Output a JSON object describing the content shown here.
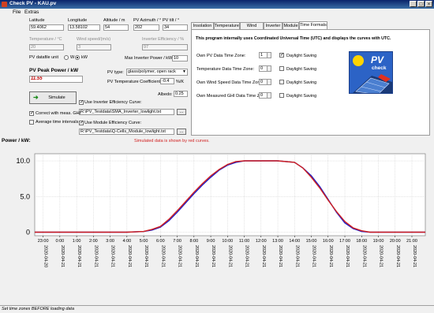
{
  "window": {
    "title": "Check PV - KAU.pv",
    "min": "_",
    "max": "□",
    "close": "×"
  },
  "menu": {
    "file": "File",
    "extras": "Extras"
  },
  "site": {
    "latitude_label": "Latitude",
    "latitude": "59.4062",
    "longitude_label": "Longitude",
    "longitude": "13.58102",
    "altitude_label": "Altitude / m",
    "altitude": "54",
    "azimuth_label": "PV Azimuth / °",
    "azimuth": "202",
    "tilt_label": "PV tilt / °",
    "tilt": "34"
  },
  "temperature": {
    "label": "Temperature / °C",
    "value": "20"
  },
  "wind": {
    "label": "Wind speed/(m/s)",
    "value": "3"
  },
  "inverter_eff": {
    "label": "Inverter Efficiency / %",
    "value": "97"
  },
  "datafile_unit": {
    "label": "PV datafile unit",
    "opt_w": "W",
    "opt_kw": "kW"
  },
  "max_inverter": {
    "label": "Max Inverter Power / kW:",
    "value": "10"
  },
  "peak_power": {
    "label": "PV Peak Power / kW",
    "value": "11.55"
  },
  "pv_type": {
    "label": "PV type:",
    "value": "glass/polymer, open rack"
  },
  "temp_coeff": {
    "label": "PV Temperature Coefficient:",
    "value": "-0.4",
    "unit": "%/K"
  },
  "simulate_button": "Simulate",
  "correct_ghi": "Correct with meas. GHI",
  "average_intervals": "Average time intervals",
  "albedo": {
    "label": "Albedo:",
    "value": "0.25"
  },
  "inverter_curve": {
    "label": "Use Inverter Efficiency Curve:",
    "path": "R:\\PV_Testdata\\SMA_Inverter_lowlight.txt",
    "browse": "..."
  },
  "module_curve": {
    "label": "Use Module Efficiency Curve:",
    "path": "R:\\PV_Testdata\\Q-Cells_Module_lowlight.txt",
    "browse": "..."
  },
  "sim_note": "Simulated data is shown by red curves.",
  "tabs": [
    "Insolation",
    "Temperature",
    "Wind speed",
    "Inverter",
    "Module",
    "Time Formats"
  ],
  "time_formats": {
    "info": "This program internally uses Coordinated Universal Time (UTC) and displays the curves with UTC.",
    "daylight_label": "Daylight Saving",
    "rows": [
      {
        "label": "Own PV Data Time Zone:",
        "value": "1",
        "dst": true
      },
      {
        "label": "Temperature Data Time Zone:",
        "value": "0",
        "dst": false
      },
      {
        "label": "Own Wind Speed Data Time Zone:",
        "value": "0",
        "dst": false
      },
      {
        "label": "Own Measured GHI Data Time Zone:",
        "value": "0",
        "dst": false
      }
    ]
  },
  "logo": {
    "line1": "PV",
    "line2": "check"
  },
  "status": "Set time zones BEFORE loading data",
  "chart_data": {
    "type": "line",
    "ylabel": "Power / kW:",
    "ylim": [
      -0.5,
      11
    ],
    "yticks": [
      0,
      5.0,
      10.0
    ],
    "yticklabels": [
      "0",
      "5.0",
      "10.0"
    ],
    "xticklabels": [
      "23:00",
      "0:00",
      "1:00",
      "2:00",
      "3:00",
      "4:00",
      "5:00",
      "6:00",
      "7:00",
      "8:00",
      "9:00",
      "10:00",
      "11:00",
      "12:00",
      "13:00",
      "14:00",
      "15:00",
      "16:00",
      "17:00",
      "18:00",
      "19:00",
      "20:00",
      "21:00"
    ],
    "xdates": [
      "2020-04-20",
      "2020-04-21",
      "2020-04-21",
      "2020-04-21",
      "2020-04-21",
      "2020-04-21",
      "2020-04-21",
      "2020-04-21",
      "2020-04-21",
      "2020-04-21",
      "2020-04-21",
      "2020-04-21",
      "2020-04-21",
      "2020-04-21",
      "2020-04-21",
      "2020-04-21",
      "2020-04-21",
      "2020-04-21",
      "2020-04-21",
      "2020-04-21",
      "2020-04-21",
      "2020-04-21",
      "2020-04-21"
    ],
    "grid": true,
    "series": [
      {
        "color": "#1c1cc8",
        "x": [
          -1.5,
          4.0,
          5.0,
          5.5,
          6.0,
          6.5,
          7.0,
          7.5,
          8.0,
          8.5,
          9.0,
          9.5,
          10.0,
          10.5,
          11.0,
          12.0,
          13.0,
          14.0,
          14.5,
          15.0,
          15.5,
          16.0,
          16.5,
          17.0,
          17.5,
          18.0,
          18.5,
          19.0,
          21.8
        ],
        "y": [
          0,
          0,
          0.1,
          0.3,
          0.7,
          1.6,
          2.8,
          4.1,
          5.4,
          6.6,
          7.7,
          8.7,
          9.4,
          9.8,
          10.0,
          10.0,
          10.0,
          9.8,
          9.0,
          7.9,
          6.4,
          4.6,
          2.8,
          1.3,
          0.5,
          0.1,
          0,
          0,
          0
        ]
      },
      {
        "color": "#d02020",
        "x": [
          -1.5,
          4.0,
          5.0,
          5.5,
          6.0,
          6.5,
          7.0,
          7.5,
          8.0,
          8.5,
          9.0,
          9.5,
          10.0,
          10.5,
          11.0,
          12.0,
          13.0,
          14.0,
          14.5,
          15.0,
          15.5,
          16.0,
          16.5,
          17.0,
          17.5,
          18.0,
          18.5,
          19.0,
          21.8
        ],
        "y": [
          0,
          0,
          0.1,
          0.4,
          0.8,
          1.8,
          3.0,
          4.3,
          5.6,
          6.8,
          7.9,
          8.8,
          9.5,
          9.9,
          10.0,
          10.0,
          10.0,
          9.8,
          9.0,
          7.7,
          6.2,
          4.5,
          2.9,
          1.5,
          0.6,
          0.2,
          0,
          0,
          0
        ]
      }
    ]
  }
}
